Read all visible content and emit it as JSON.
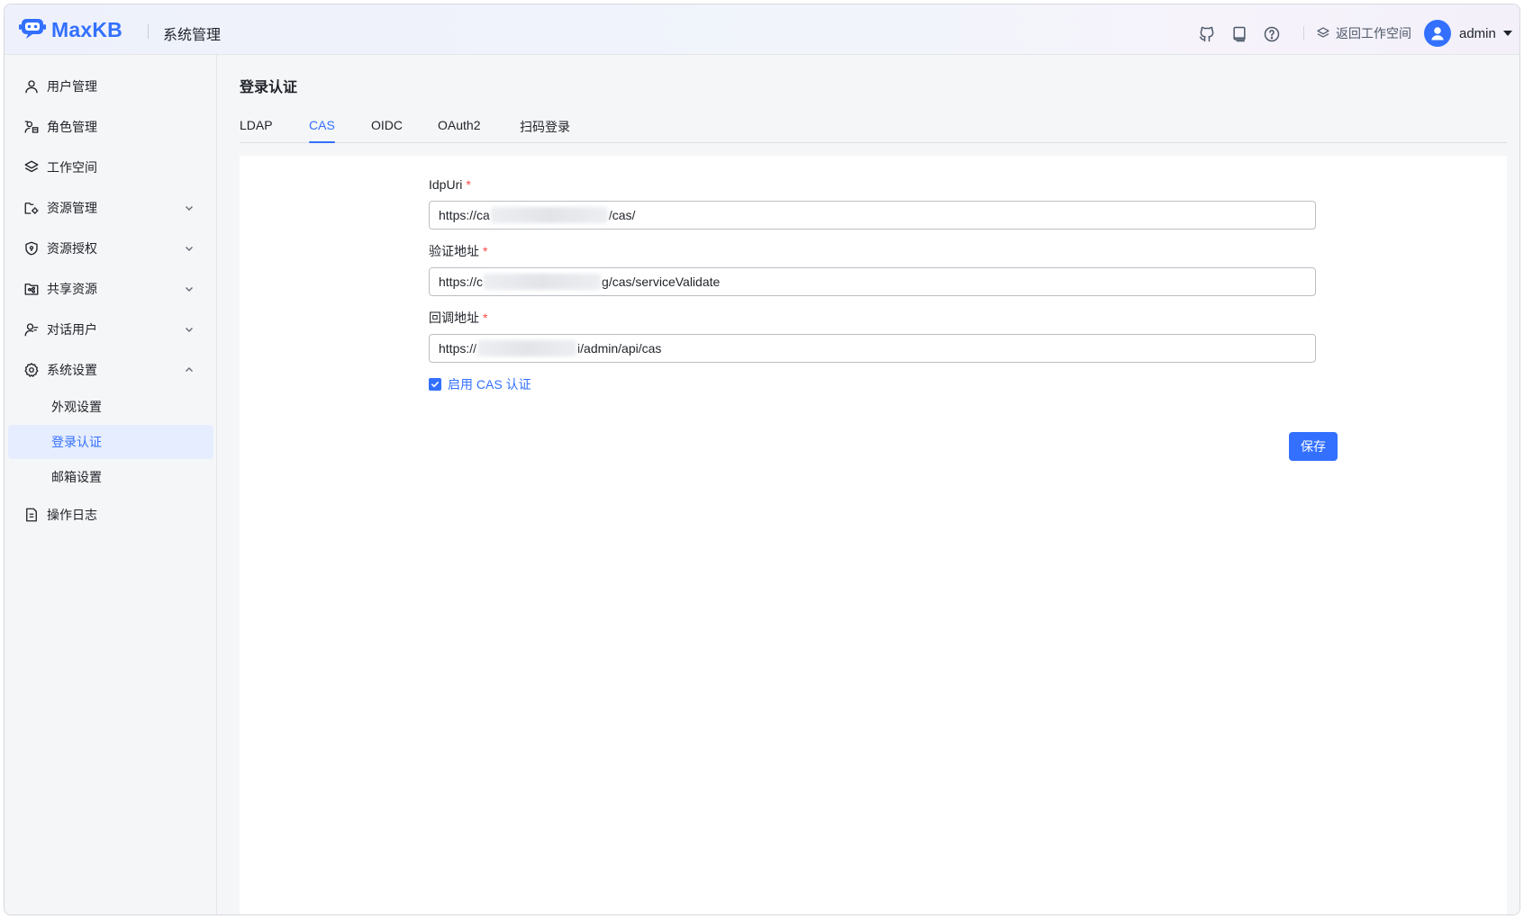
{
  "header": {
    "logo_text": "MaxKB",
    "title": "系统管理",
    "back_workspace_label": "返回工作空间",
    "user_name": "admin",
    "icons": [
      "github-icon",
      "book-icon",
      "help-icon",
      "layers-icon"
    ]
  },
  "sidebar": {
    "items": [
      {
        "label": "用户管理",
        "icon": "user-icon"
      },
      {
        "label": "角色管理",
        "icon": "role-icon"
      },
      {
        "label": "工作空间",
        "icon": "layers-icon"
      },
      {
        "label": "资源管理",
        "icon": "folder-settings-icon",
        "expandable": true
      },
      {
        "label": "资源授权",
        "icon": "shield-icon",
        "expandable": true
      },
      {
        "label": "共享资源",
        "icon": "shared-folder-icon",
        "expandable": true
      },
      {
        "label": "对话用户",
        "icon": "chat-user-icon",
        "expandable": true
      },
      {
        "label": "系统设置",
        "icon": "gear-icon",
        "expanded": true
      },
      {
        "label": "操作日志",
        "icon": "document-icon"
      }
    ],
    "sub_items": [
      {
        "label": "外观设置",
        "active": false
      },
      {
        "label": "登录认证",
        "active": true
      },
      {
        "label": "邮箱设置",
        "active": false
      }
    ]
  },
  "main": {
    "page_title": "登录认证",
    "tabs": [
      {
        "label": "LDAP",
        "active": false
      },
      {
        "label": "CAS",
        "active": true
      },
      {
        "label": "OIDC",
        "active": false
      },
      {
        "label": "OAuth2",
        "active": false
      },
      {
        "label": "扫码登录",
        "active": false
      }
    ],
    "form": {
      "idp_uri": {
        "label": "IdpUri",
        "value_prefix": "https://ca",
        "value_suffix": "/cas/"
      },
      "validate_url": {
        "label": "验证地址",
        "value_prefix": "https://c",
        "value_suffix": "g/cas/serviceValidate"
      },
      "callback_url": {
        "label": "回调地址",
        "value_prefix": "https://",
        "value_suffix": "i/admin/api/cas"
      },
      "enable_checkbox": {
        "label": "启用 CAS 认证",
        "checked": true
      },
      "save_label": "保存"
    }
  },
  "colors": {
    "accent": "#3370ff",
    "required": "#f54a45",
    "active_bg": "#e6edfe"
  }
}
